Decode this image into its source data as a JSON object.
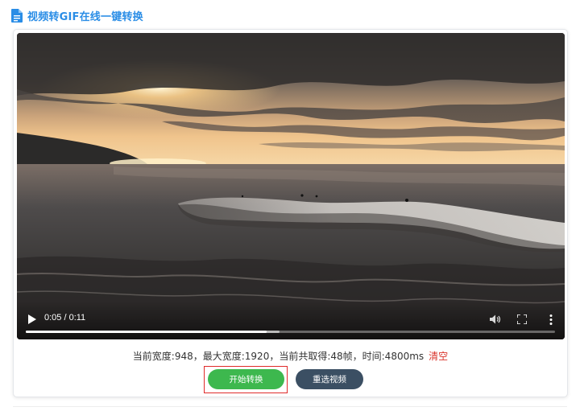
{
  "header": {
    "title": "视频转GIF在线一键转换",
    "icon": "document-icon"
  },
  "video": {
    "current_time": "0:05",
    "duration": "0:11",
    "time_display": "0:05 / 0:11",
    "played_fraction": 0.455,
    "buffered_fraction": 0.48,
    "icons": {
      "play": "play-icon",
      "volume": "volume-icon",
      "fullscreen": "fullscreen-icon",
      "more": "more-options-icon"
    }
  },
  "info": {
    "text": "当前宽度:948，最大宽度:1920，当前共取得:48帧，时间:4800ms",
    "clear_label": "清空"
  },
  "actions": {
    "start_label": "开始转换",
    "reselect_label": "重选视频"
  },
  "colors": {
    "accent": "#2a8de6",
    "start_button": "#3db84e",
    "reselect_button": "#3b4f63",
    "clear_link": "#d9342b",
    "highlight": "#e02a2a"
  }
}
